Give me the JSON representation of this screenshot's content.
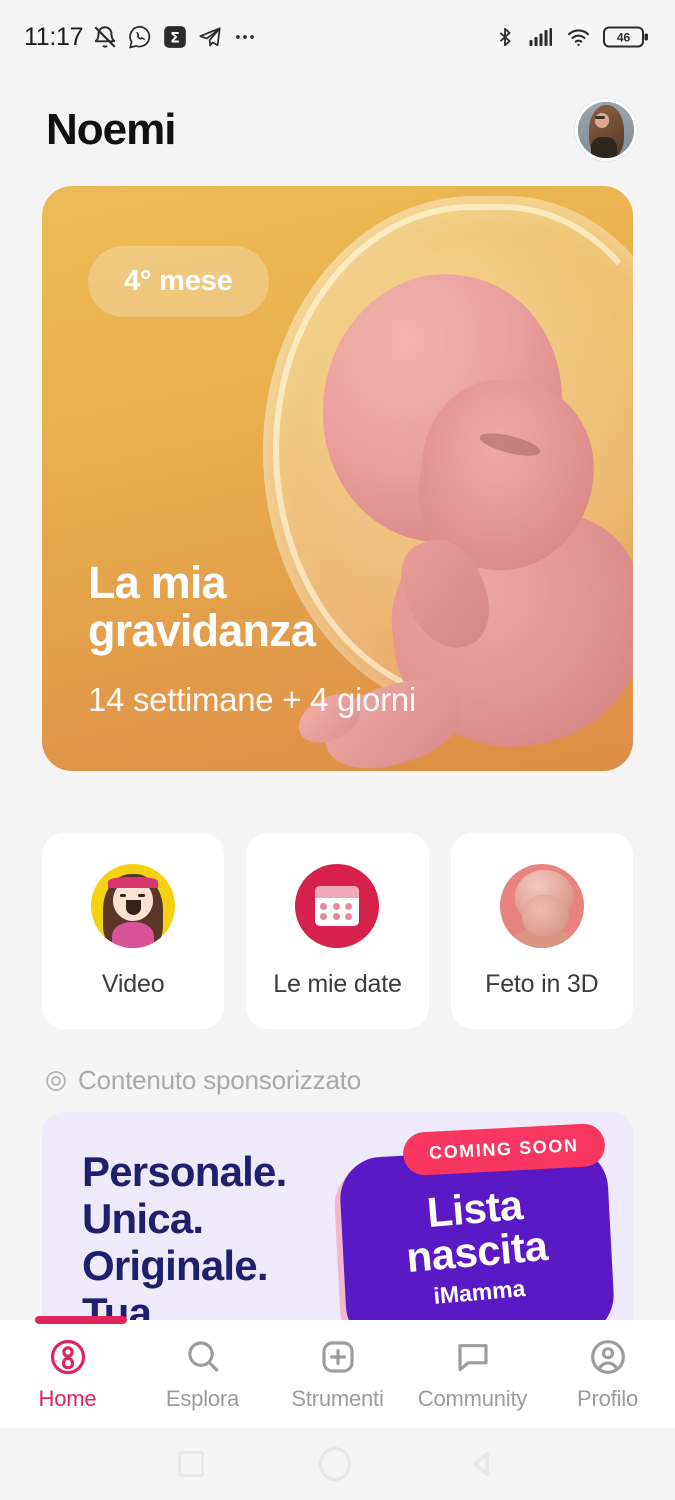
{
  "statusbar": {
    "time": "11:17",
    "left_icons": [
      "bell-off-icon",
      "whatsapp-icon",
      "sigma-app-icon",
      "telegram-icon",
      "more-dots-icon"
    ],
    "right_icons": [
      "bluetooth-icon",
      "signal-bars-icon",
      "wifi-icon",
      "battery-icon"
    ],
    "battery_level": "46"
  },
  "header": {
    "title": "Noemi",
    "avatar_alt": "profile-photo"
  },
  "hero": {
    "month_badge": "4° mese",
    "title": "La mia\ngravidanza",
    "subtitle": "14 settimane + 4 giorni",
    "bg_start": "#ecbb56",
    "bg_end": "#de8d45"
  },
  "tiles": [
    {
      "label": "Video",
      "icon": "girl-avatar-icon",
      "color": "#F5D211"
    },
    {
      "label": "Le mie date",
      "icon": "calendar-icon",
      "color": "#D6214C"
    },
    {
      "label": "Feto in 3D",
      "icon": "fetus-3d-icon",
      "color": "#e8837f"
    }
  ],
  "sponsored": {
    "label": "Contenuto sponsorizzato",
    "icon": "target-circle-icon"
  },
  "ad": {
    "headline": "Personale.\nUnica.\nOriginale.\nTua.",
    "badge": "COMING SOON",
    "blob_line1": "Lista",
    "blob_line2": "nascita",
    "blob_line3": "iMamma",
    "bg": "#eeeaf9",
    "blob_color": "#5a19c4",
    "badge_color": "#f8365f",
    "headline_color": "#1f1f6e"
  },
  "bottomnav": {
    "accent": "#E0245E",
    "items": [
      {
        "label": "Home",
        "icon": "home-baby-icon",
        "active": true
      },
      {
        "label": "Esplora",
        "icon": "search-icon",
        "active": false
      },
      {
        "label": "Strumenti",
        "icon": "plus-square-icon",
        "active": false
      },
      {
        "label": "Community",
        "icon": "chat-bubble-icon",
        "active": false
      },
      {
        "label": "Profilo",
        "icon": "person-circle-icon",
        "active": false
      }
    ]
  },
  "androidnav": {
    "icons": [
      "recents-square-icon",
      "home-circle-icon",
      "back-triangle-icon"
    ]
  }
}
